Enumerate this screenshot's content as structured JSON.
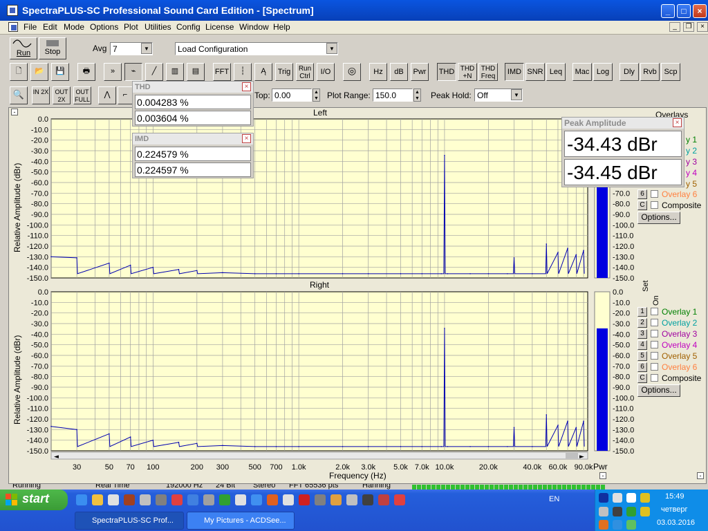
{
  "window": {
    "title": "SpectraPLUS-SC Professional Sound Card Edition - [Spectrum]"
  },
  "menu": [
    "File",
    "Edit",
    "Mode",
    "Options",
    "Plot",
    "Utilities",
    "Config",
    "License",
    "Window",
    "Help"
  ],
  "toolbar1": {
    "run": "Run",
    "stop": "Stop",
    "avg_label": "Avg",
    "avg_value": "7",
    "load_config": "Load Configuration"
  },
  "toolbar2": [
    "FFT",
    "Trig",
    "Run Ctrl",
    "I/O",
    "Hz",
    "dB",
    "Pwr",
    "THD",
    "THD +N",
    "THD Freq",
    "IMD",
    "SNR",
    "Leq",
    "Mac",
    "Log",
    "Dly",
    "Rvb",
    "Scp"
  ],
  "toolbar3": {
    "top_label": "Top:",
    "top_value": "0.00",
    "range_label": "Plot Range:",
    "range_value": "150.0",
    "peak_label": "Peak Hold:",
    "peak_value": "Off"
  },
  "zoom_buttons": [
    "IN 2X",
    "OUT 2X",
    "OUT FULL"
  ],
  "thd": {
    "title": "THD",
    "v1": "0.004283 %",
    "v2": "0.003604 %"
  },
  "imd": {
    "title": "IMD",
    "v1": "0.224579 %",
    "v2": "0.224597 %"
  },
  "peak": {
    "title": "Peak Amplitude",
    "v1": "-34.43 dBr",
    "v2": "-34.45 dBr"
  },
  "plots": {
    "left_title": "Left",
    "right_title": "Right",
    "ylabel": "Relative Amplitude (dBr)",
    "xlabel": "Frequency (Hz)",
    "yticks": [
      "0.0",
      "-10.0",
      "-20.0",
      "-30.0",
      "-40.0",
      "-50.0",
      "-60.0",
      "-70.0",
      "-80.0",
      "-90.0",
      "-100.0",
      "-110.0",
      "-120.0",
      "-130.0",
      "-140.0",
      "-150.0"
    ],
    "xticks": [
      "30",
      "50",
      "70",
      "100",
      "200",
      "300",
      "500",
      "700",
      "1.0k",
      "2.0k",
      "3.0k",
      "5.0k",
      "7.0k",
      "10.0k",
      "20.0k",
      "40.0k",
      "60.0k",
      "90.0k"
    ],
    "pwr": "Pwr"
  },
  "overlays": {
    "header": "Overlays",
    "set": "Set",
    "on": "On",
    "items": [
      {
        "n": "1",
        "label": "Overlay 1",
        "color": "#008000"
      },
      {
        "n": "2",
        "label": "Overlay 2",
        "color": "#00a0a0"
      },
      {
        "n": "3",
        "label": "Overlay 3",
        "color": "#a000a0"
      },
      {
        "n": "4",
        "label": "Overlay 4",
        "color": "#c000c0"
      },
      {
        "n": "5",
        "label": "Overlay 5",
        "color": "#a06000"
      },
      {
        "n": "6",
        "label": "Overlay 6",
        "color": "#ff8040"
      },
      {
        "n": "C",
        "label": "Composite",
        "color": "#000000"
      }
    ],
    "options": "Options..."
  },
  "upper_panel_visible": {
    "y1": "y 1",
    "y2": "y 2",
    "y3": "y 3",
    "y4": "y 4",
    "y5": "y 5"
  },
  "status": [
    "Running",
    "Real Time",
    "192000 Hz",
    "24 Bit",
    "Stereo",
    "FFT 65536 pts",
    "Hanning"
  ],
  "taskbar": {
    "start": "start",
    "lang": "EN",
    "time": "15:49",
    "day": "четверг",
    "date": "03.03.2016",
    "tasks": [
      "SpectraPLUS-SC Prof...",
      "My Pictures - ACDSee..."
    ]
  },
  "chart_data": [
    {
      "type": "line",
      "title": "Left",
      "xlabel": "Frequency (Hz)",
      "ylabel": "Relative Amplitude (dBr)",
      "xscale": "log",
      "xlim": [
        20,
        96000
      ],
      "ylim": [
        -150,
        0
      ],
      "series": [
        {
          "x": [
            20,
            30,
            50,
            70,
            100,
            150,
            200,
            300,
            500,
            700,
            1000,
            2000,
            3000,
            5000,
            7000,
            9500,
            10000,
            10500,
            15000,
            20000,
            27000,
            30000,
            40000,
            50000,
            60000,
            70000,
            80000,
            90000
          ],
          "y": [
            -130,
            -131,
            -136,
            -138,
            -140,
            -142,
            -143,
            -145,
            -146,
            -146,
            -146,
            -146,
            -146,
            -146,
            -146,
            -146,
            -34.4,
            -146,
            -146,
            -146,
            -146,
            -131,
            -146,
            -118,
            -126,
            -122,
            -128,
            -124
          ]
        }
      ]
    },
    {
      "type": "line",
      "title": "Right",
      "xlabel": "Frequency (Hz)",
      "ylabel": "Relative Amplitude (dBr)",
      "xscale": "log",
      "xlim": [
        20,
        96000
      ],
      "ylim": [
        -150,
        0
      ],
      "series": [
        {
          "x": [
            20,
            30,
            50,
            70,
            100,
            150,
            200,
            300,
            500,
            700,
            1000,
            2000,
            3000,
            5000,
            7000,
            9500,
            10000,
            10500,
            15000,
            20000,
            27000,
            30000,
            40000,
            50000,
            60000,
            70000,
            80000,
            90000
          ],
          "y": [
            -127,
            -130,
            -134,
            -137,
            -140,
            -142,
            -143,
            -145,
            -146,
            -146,
            -146,
            -146,
            -146,
            -146,
            -146,
            -146,
            -34.5,
            -146,
            -146,
            -146,
            -146,
            -128,
            -146,
            -116,
            -126,
            -122,
            -128,
            -122
          ]
        }
      ]
    }
  ]
}
